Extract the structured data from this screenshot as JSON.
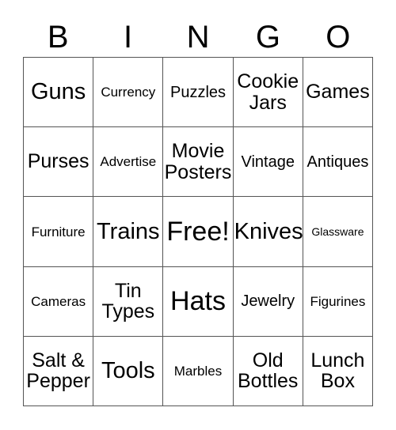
{
  "card": {
    "title_letters": [
      "B",
      "I",
      "N",
      "G",
      "O"
    ],
    "free_space_label": "Free!",
    "border_color": "#555555",
    "text_color": "#000000",
    "background_color": "#ffffff",
    "rows": [
      [
        {
          "label": "Guns",
          "size": "fs-lg",
          "lines": 1
        },
        {
          "label": "Currency",
          "size": "fs-xs",
          "lines": 1
        },
        {
          "label": "Puzzles",
          "size": "fs-sm",
          "lines": 1
        },
        {
          "label": "Cookie\nJars",
          "size": "fs-md",
          "lines": 2
        },
        {
          "label": "Games",
          "size": "fs-md",
          "lines": 1
        }
      ],
      [
        {
          "label": "Purses",
          "size": "fs-md",
          "lines": 1
        },
        {
          "label": "Advertise",
          "size": "fs-xs",
          "lines": 1
        },
        {
          "label": "Movie\nPosters",
          "size": "fs-md",
          "lines": 2
        },
        {
          "label": "Vintage",
          "size": "fs-sm",
          "lines": 1
        },
        {
          "label": "Antiques",
          "size": "fs-sm",
          "lines": 1
        }
      ],
      [
        {
          "label": "Furniture",
          "size": "fs-xs",
          "lines": 1
        },
        {
          "label": "Trains",
          "size": "fs-lg",
          "lines": 1
        },
        {
          "label": "Free!",
          "size": "fs-xl",
          "lines": 1
        },
        {
          "label": "Knives",
          "size": "fs-lg",
          "lines": 1
        },
        {
          "label": "Glassware",
          "size": "fs-xxs",
          "lines": 1
        }
      ],
      [
        {
          "label": "Cameras",
          "size": "fs-xs",
          "lines": 1
        },
        {
          "label": "Tin\nTypes",
          "size": "fs-md",
          "lines": 2
        },
        {
          "label": "Hats",
          "size": "fs-xl",
          "lines": 1
        },
        {
          "label": "Jewelry",
          "size": "fs-sm",
          "lines": 1
        },
        {
          "label": "Figurines",
          "size": "fs-xs",
          "lines": 1
        }
      ],
      [
        {
          "label": "Salt &\nPepper",
          "size": "fs-md",
          "lines": 2
        },
        {
          "label": "Tools",
          "size": "fs-lg",
          "lines": 1
        },
        {
          "label": "Marbles",
          "size": "fs-xs",
          "lines": 1
        },
        {
          "label": "Old\nBottles",
          "size": "fs-md",
          "lines": 2
        },
        {
          "label": "Lunch\nBox",
          "size": "fs-md",
          "lines": 2
        }
      ]
    ]
  }
}
